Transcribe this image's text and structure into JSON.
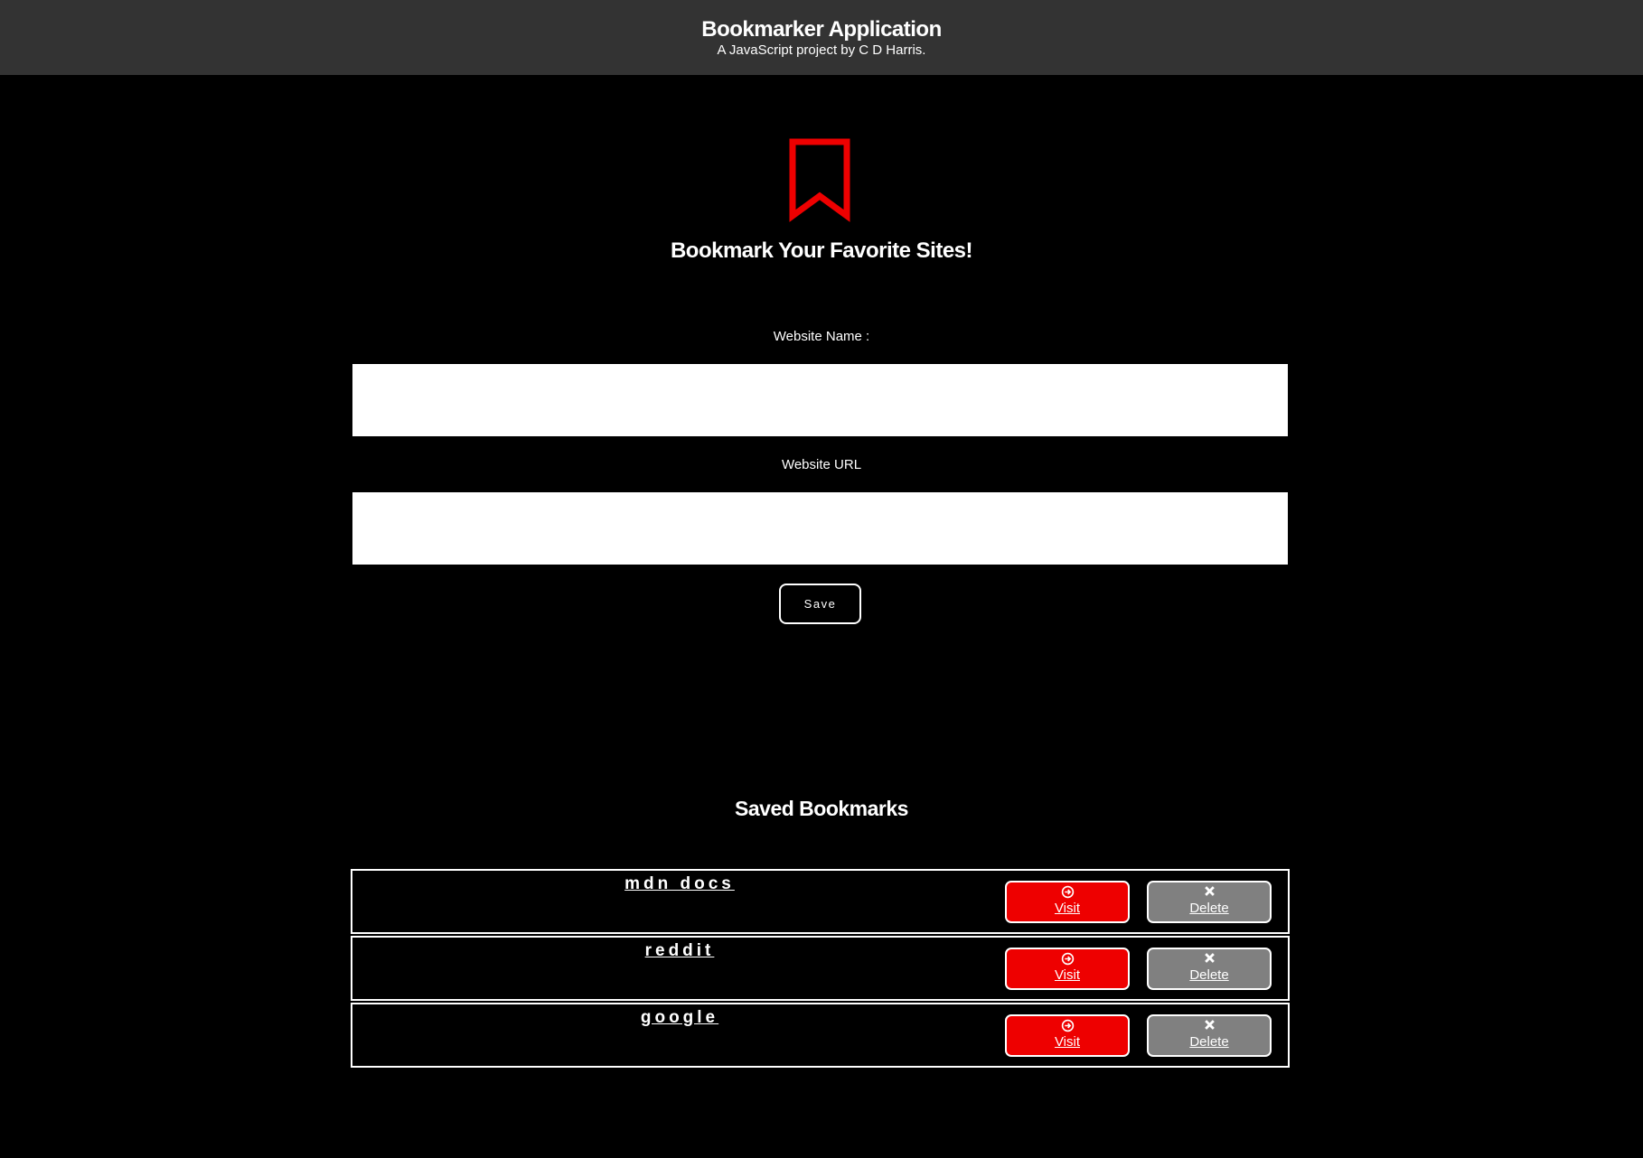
{
  "header": {
    "title": "Bookmarker Application",
    "subtitle": "A JavaScript project by C D Harris."
  },
  "hero": {
    "icon": "bookmark-icon",
    "title": "Bookmark Your Favorite Sites!"
  },
  "form": {
    "name_label": "Website Name :",
    "name_value": "",
    "url_label": "Website URL",
    "url_value": "",
    "save_label": "Save"
  },
  "saved": {
    "title": "Saved Bookmarks",
    "visit_icon": "arrow-circle-right-icon",
    "delete_icon": "x-icon",
    "items": [
      {
        "name": "mdn docs",
        "visit_label": "Visit",
        "delete_label": "Delete"
      },
      {
        "name": "reddit",
        "visit_label": "Visit",
        "delete_label": "Delete"
      },
      {
        "name": "google",
        "visit_label": "Visit",
        "delete_label": "Delete"
      }
    ]
  },
  "colors": {
    "background": "#000000",
    "header_bg": "#333333",
    "accent": "#ee0000",
    "delete_bg": "#808080",
    "text": "#ffffff"
  }
}
